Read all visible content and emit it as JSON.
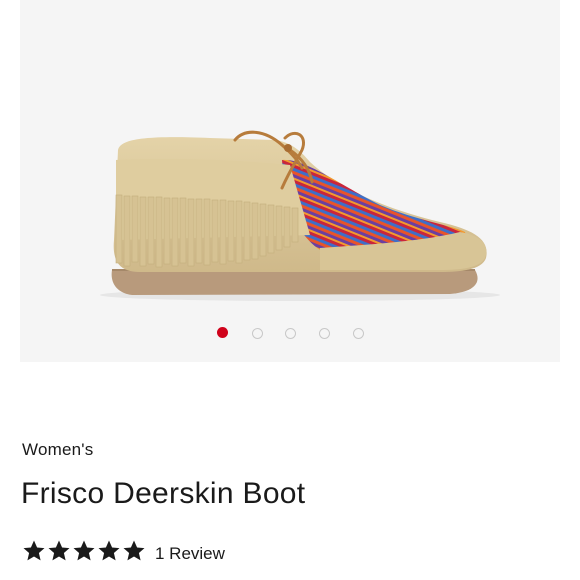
{
  "product": {
    "category": "Women's",
    "name": "Frisco Deerskin Boot",
    "rating": 5,
    "rating_max": 5,
    "review_text": "1 Review"
  },
  "gallery": {
    "image_count": 5,
    "active_index": 0,
    "image_icon": "fringe-boot-image"
  },
  "colors": {
    "accent": "#d0021b",
    "dot_inactive": "#c8c8c8",
    "star": "#1a1a1a",
    "gallery_bg": "#f5f5f5",
    "leather": "#dcc99a",
    "sole": "#b89a7c"
  }
}
